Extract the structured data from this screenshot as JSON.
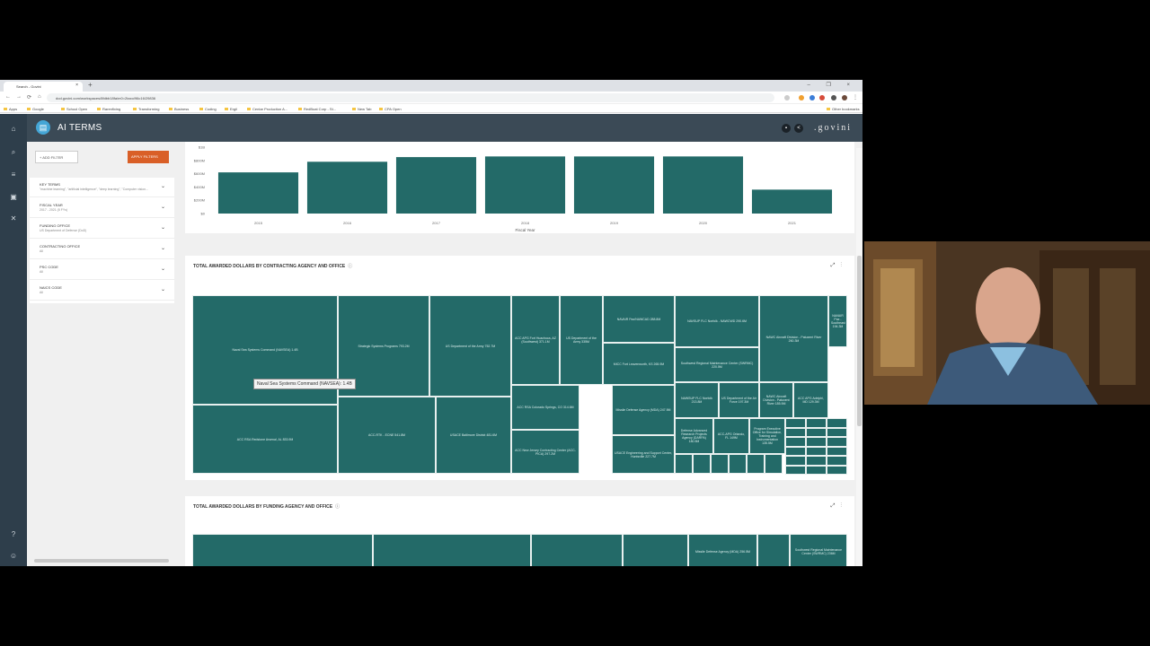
{
  "browser": {
    "tab_title": "Search - Govini",
    "new_tab_symbol": "+",
    "close_symbol": "×",
    "window_controls": "–  ❐  ×",
    "url": "dod.govini.com/workspaces/8fdbb18fa/m0=2taxo/96c16/29836",
    "bookmarks": [
      "Apps",
      "Google",
      "School Open",
      "Rarenfixing",
      "Transforming",
      "Business",
      "Coding",
      "Ergil",
      "Centar Production A...",
      "RedBoat Corp - St...",
      "New Tab",
      "CPA Open",
      "Other bookmarks"
    ]
  },
  "app": {
    "title": "AI TERMS",
    "brand": ".govini",
    "logo_glyph": "▤"
  },
  "filters": {
    "add_label": "+ ADD FILTER",
    "apply_label": "APPLY FILTERS",
    "items": [
      {
        "name": "KEY TERMS",
        "value": "\"machine learning\", \"artificial intelligence\", \"deep learning\", \"Computer vision..."
      },
      {
        "name": "FISCAL YEAR",
        "value": "2017 - 2021 (5 FYs)"
      },
      {
        "name": "FUNDING OFFICE",
        "value": "US Department of Defense (DoD)"
      },
      {
        "name": "CONTRACTING OFFICE",
        "value": "All"
      },
      {
        "name": "PSC CODE",
        "value": "All"
      },
      {
        "name": "NAICS CODE",
        "value": "All"
      }
    ]
  },
  "bar_section": {
    "chart_data": {
      "type": "bar",
      "categories": [
        "2015",
        "2016",
        "2017",
        "2018",
        "2019",
        "2020",
        "2021"
      ],
      "values": [
        620,
        780,
        850,
        860,
        860,
        860,
        360
      ],
      "ylim": [
        0,
        1000
      ],
      "yticks": [
        "$0",
        "$200M",
        "$400M",
        "$600M",
        "$800M",
        "$1B"
      ],
      "xlabel": "Fiscal Year",
      "ylabel": "",
      "color": "#236a68",
      "grid": false
    }
  },
  "contracting_section": {
    "title": "TOTAL AWARDED DOLLARS BY CONTRACTING AGENCY AND OFFICE",
    "info_icon": "ⓘ",
    "tooltip": "Naval Sea Systems Command (NAVSEA): 1.4B",
    "tiles": [
      "Naval Sea Systems Command (NAVSEA) 1.4B",
      "ACC RSA Redstone Arsenal, AL 833.9M",
      "Strategic Systems Programs 793.2M",
      "US Department of the Army 752.7M",
      "ACC-RTK - ECNE 541.8M",
      "USACE Baltimore District 481.6M",
      "ACC APG Fort Huachuca, AZ (Southwest) 371.1M",
      "US Department of the Army 335M",
      "ACC RSA Colorado Springs, CO 314.6M",
      "ACC New Jersey Contracting Center (ACC-PICA) 297.2M",
      "NAVAIR Pax/NAWCAD 288.8M",
      "NAVSUP FLC Norfolk - NAWCWD 290.6M",
      "MICC Fort Leavenworth, KS 265.9M",
      "NAWC Aircraft Division - Patuxent River 260.3M",
      "Missile Defense Agency (MDA) 247.9M",
      "USACE Engineering and Support Center, Huntsville 227.7M",
      "Southwest Regional Maintenance Center (SWRMC) 220.5M",
      "NAVAIR Pax - Southeast 194.3M",
      "NAWSUP FLC Norfolk 213.8M",
      "US Department of the Air Force 197.3M",
      "NAWC Aircraft Division - Patuxent River 185.9M",
      "ACC APG Adelphi, MD 129.3M",
      "Defense Advanced Research Projects Agency (DARPA) 180.5M",
      "ACC-APG Orlando, FL 149M",
      "Program Executive Office for Simulation, Training and Instrumentation 135.5M"
    ]
  },
  "funding_section": {
    "title": "TOTAL AWARDED DOLLARS BY FUNDING AGENCY AND OFFICE",
    "info_icon": "ⓘ",
    "tiles": [
      "Missile Defense Agency (MDA) 256.5M",
      "Southwest Regional Maintenance Center (SWRMC) 236M"
    ]
  }
}
